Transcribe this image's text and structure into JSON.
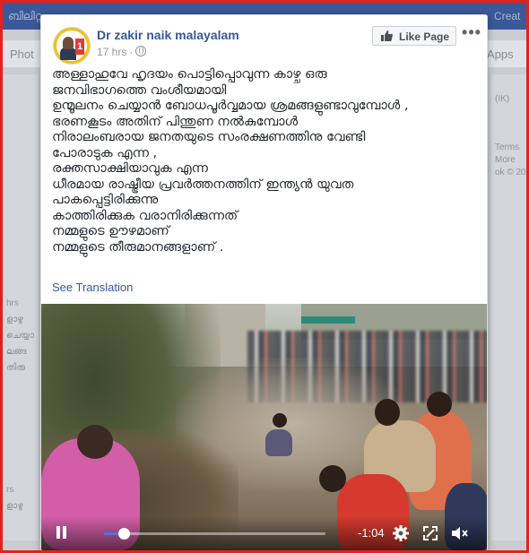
{
  "background": {
    "topbar_left": "ബിലിറ്റ",
    "topbar_right": "Creat",
    "nav_left": "Phot",
    "nav_right": "Apps",
    "right_col": [
      "(IK)",
      "Terms",
      "More",
      "ok © 20"
    ],
    "left_col": [
      "hrs",
      "ളാഴു",
      "ചെയ്യാ",
      "ലങ്ങ",
      "തിരു",
      "rs",
      "ളാഴു"
    ]
  },
  "post": {
    "page_name": "Dr zakir naik malayalam",
    "timestamp": "17 hrs",
    "privacy_icon": "globe-icon",
    "like_page_label": "Like Page",
    "more_icon": "more-options-icon",
    "text_lines": [
      "അള്ളാഹുവേ ഹൃദയം പൊട്ടിപ്പൊവുന്ന കാഴ്ച ഒരു",
      "ജനവിഭാഗത്തെ വംശീയമായി",
      "ഉന്മൂലനം ചെയ്യാൻ ബോധപൂർവ്വമായ ശ്രമങ്ങളുണ്ടാവുമ്പോൾ ,",
      "ഭരണകൂടം അതിന് പിന്തുണ നൽകുമ്പോൾ",
      "നിരാലംബരായ ജനതയുടെ സംരക്ഷണത്തിനു വേണ്ടി",
      "പോരാടുക എന്ന ,",
      "രക്തസാക്ഷിയാവുക എന്ന",
      "ധീരമായ രാഷ്ട്രീയ പ്രവർത്തനത്തിന് ഇന്ത്യൻ യുവത",
      "പാകപ്പെട്ടിരിക്കുന്നു",
      "കാത്തിരിക്കുക വരാനിരിക്കുന്നത്",
      "നമ്മളുടെ ഊഴമാണ്",
      "നമ്മളുടെ തീരുമാനങ്ങളാണ് ."
    ],
    "see_translation": "See Translation"
  },
  "video": {
    "time_remaining": "-1:04",
    "progress_fraction": 0.09,
    "accent_color": "#4a76e8",
    "icons": [
      "pause-icon",
      "settings-gear-icon",
      "fullscreen-icon",
      "volume-icon"
    ]
  }
}
